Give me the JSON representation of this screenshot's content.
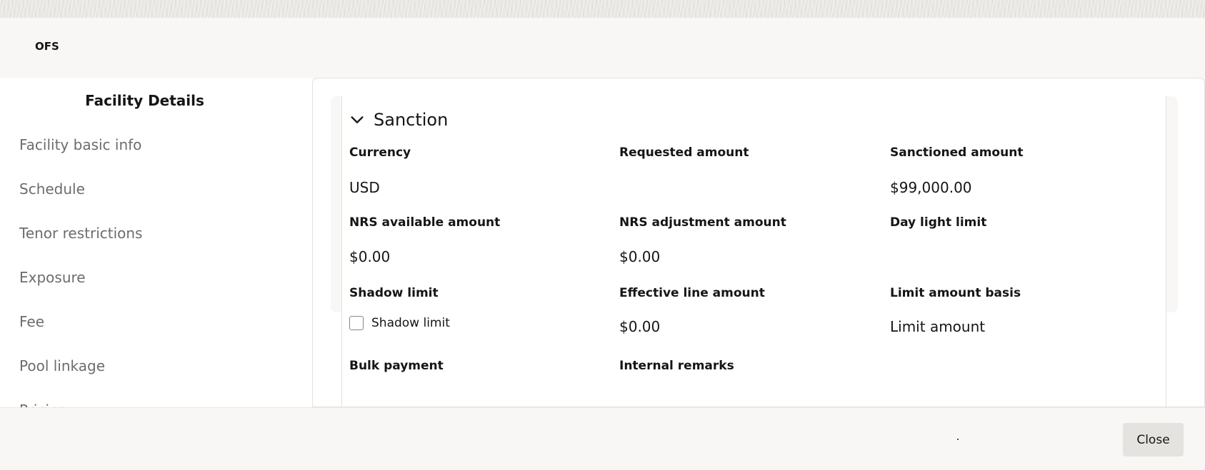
{
  "app": {
    "title": "OFS"
  },
  "sidebar": {
    "title": "Facility Details",
    "items": [
      {
        "label": "Facility basic info"
      },
      {
        "label": "Schedule"
      },
      {
        "label": "Tenor restrictions"
      },
      {
        "label": "Exposure"
      },
      {
        "label": "Fee"
      },
      {
        "label": "Pool linkage"
      },
      {
        "label": "Pricing"
      }
    ]
  },
  "section": {
    "title": "Sanction",
    "fields": {
      "currency": {
        "label": "Currency",
        "value": "USD"
      },
      "requested_amount": {
        "label": "Requested amount",
        "value": ""
      },
      "sanctioned_amount": {
        "label": "Sanctioned amount",
        "value": "$99,000.00"
      },
      "nrs_available_amount": {
        "label": "NRS available amount",
        "value": "$0.00"
      },
      "nrs_adjustment_amount": {
        "label": "NRS adjustment amount",
        "value": "$0.00"
      },
      "day_light_limit": {
        "label": "Day light limit",
        "value": ""
      },
      "shadow_limit": {
        "label": "Shadow limit",
        "checkbox_label": "Shadow limit",
        "checked": false
      },
      "effective_line_amount": {
        "label": "Effective line amount",
        "value": "$0.00"
      },
      "limit_amount_basis": {
        "label": "Limit amount basis",
        "value": "Limit amount"
      },
      "bulk_payment": {
        "label": "Bulk payment"
      },
      "internal_remarks": {
        "label": "Internal remarks"
      }
    }
  },
  "footer": {
    "close_label": "Close"
  },
  "icons": {
    "section_toggle": "chevron-down-icon",
    "loading": "loading-indicator"
  },
  "colors": {
    "background": "#f8f7f6",
    "panel": "#ffffff",
    "text": "#161513",
    "nav_text": "#6f6c69",
    "button": "#e5e3e0"
  }
}
